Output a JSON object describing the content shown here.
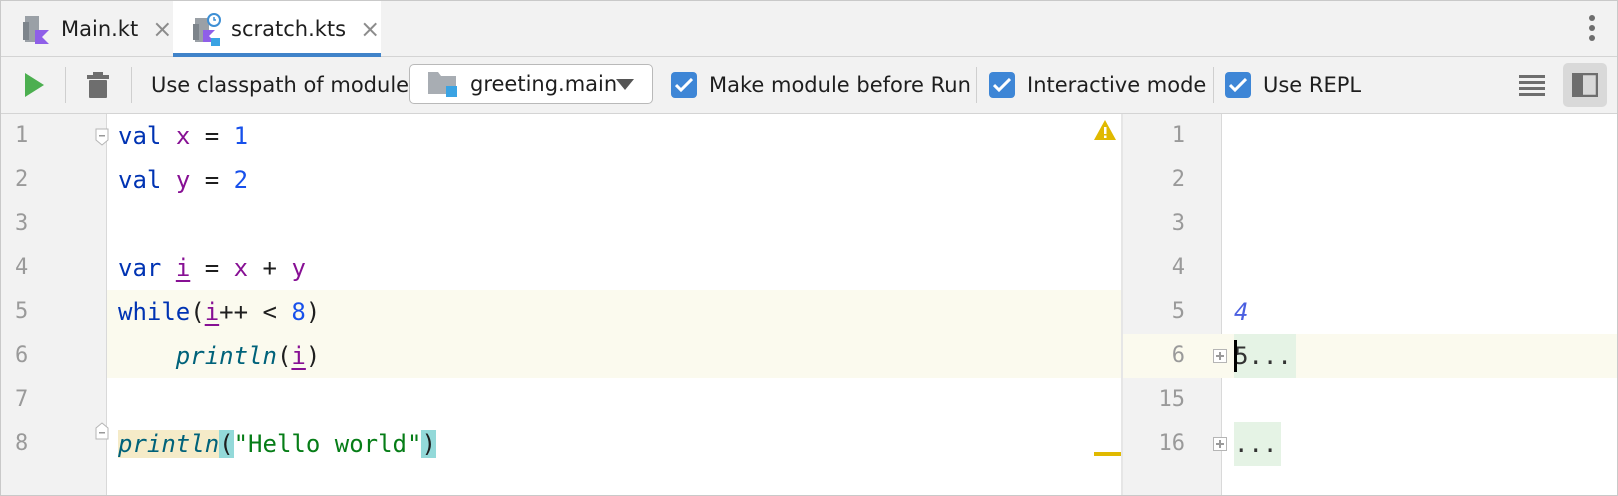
{
  "tabs": [
    {
      "label": "Main.kt",
      "close": "×",
      "active": false
    },
    {
      "label": "scratch.kts",
      "close": "×",
      "active": true
    }
  ],
  "toolbar": {
    "classpath_label": "Use classpath of module",
    "module_value": "greeting.main",
    "make_module_label": "Make module before Run",
    "interactive_label": "Interactive mode",
    "repl_label": "Use REPL"
  },
  "editor": {
    "line_numbers": [
      "1",
      "2",
      "3",
      "4",
      "5",
      "6",
      "7",
      "8"
    ],
    "lines": [
      {
        "tokens": [
          {
            "t": "val",
            "c": "kw"
          },
          {
            "t": " "
          },
          {
            "t": "x",
            "c": "vr"
          },
          {
            "t": " = "
          },
          {
            "t": "1",
            "c": "nm"
          }
        ]
      },
      {
        "tokens": [
          {
            "t": "val",
            "c": "kw"
          },
          {
            "t": " "
          },
          {
            "t": "y",
            "c": "vr"
          },
          {
            "t": " = "
          },
          {
            "t": "2",
            "c": "nm"
          }
        ]
      },
      {
        "tokens": []
      },
      {
        "tokens": [
          {
            "t": "var",
            "c": "kw"
          },
          {
            "t": " "
          },
          {
            "t": "i",
            "c": "vr ul"
          },
          {
            "t": " = "
          },
          {
            "t": "x",
            "c": "vr"
          },
          {
            "t": " + "
          },
          {
            "t": "y",
            "c": "vr"
          }
        ]
      },
      {
        "tokens": [
          {
            "t": "while",
            "c": "kw"
          },
          {
            "t": "("
          },
          {
            "t": "i",
            "c": "vr ul"
          },
          {
            "t": "++ < "
          },
          {
            "t": "8",
            "c": "nm"
          },
          {
            "t": ")"
          }
        ]
      },
      {
        "tokens": [
          {
            "t": "    "
          },
          {
            "t": "println",
            "c": "fn"
          },
          {
            "t": "("
          },
          {
            "t": "i",
            "c": "vr ul"
          },
          {
            "t": ")"
          }
        ]
      },
      {
        "tokens": []
      },
      {
        "tokens": [
          {
            "t": "println",
            "c": "fn fnhl"
          },
          {
            "t": "(",
            "c": "brk"
          },
          {
            "t": "\"Hello world\"",
            "c": "st"
          },
          {
            "t": ")",
            "c": "brk"
          }
        ]
      }
    ]
  },
  "output": {
    "line_numbers": [
      "1",
      "2",
      "3",
      "4",
      "5",
      "6",
      "15",
      "16"
    ],
    "values": {
      "line5": "4",
      "line6": "5...",
      "line16": "..."
    }
  },
  "colors": {
    "accent": "#4083c9",
    "checkbox": "#3e86d6",
    "run": "#4caf50",
    "warning": "#e0b900"
  },
  "icons": [
    "kotlin-file-icon",
    "kotlin-scratch-icon",
    "close-icon",
    "more-vert-icon",
    "run-icon",
    "trash-icon",
    "folder-module-icon",
    "chevron-down-icon",
    "checkmark-icon",
    "lines-icon",
    "side-panel-icon",
    "warning-icon",
    "expand-icon"
  ]
}
